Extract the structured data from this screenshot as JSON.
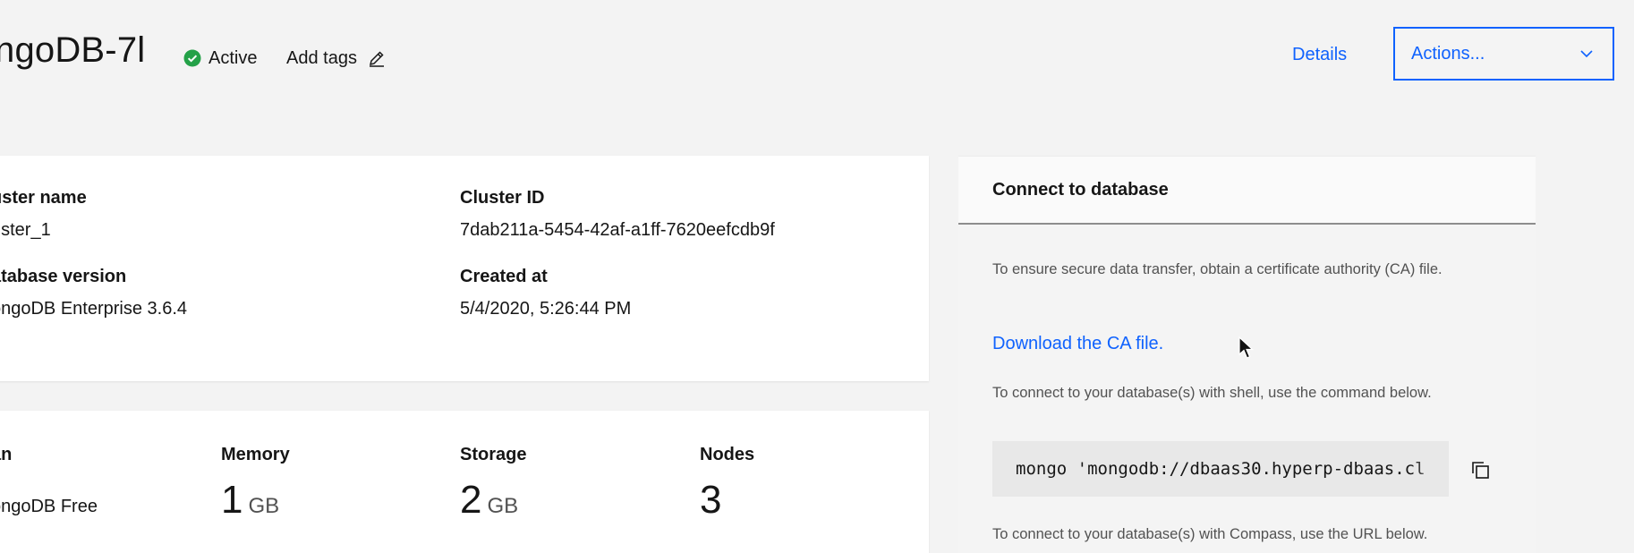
{
  "header": {
    "title": "ngoDB-7l",
    "status": "Active",
    "status_color": "#24a148",
    "add_tags_label": "Add tags",
    "details_label": "Details",
    "actions_label": "Actions..."
  },
  "overview": {
    "cluster_name_label": "uster name",
    "cluster_name_value": "uster_1",
    "cluster_id_label": "Cluster ID",
    "cluster_id_value": "7dab211a-5454-42af-a1ff-7620eefcdb9f",
    "db_version_label": "atabase version",
    "db_version_value": "ongoDB Enterprise 3.6.4",
    "created_at_label": "Created at",
    "created_at_value": "5/4/2020, 5:26:44 PM"
  },
  "plan": {
    "plan_label": "an",
    "plan_value": "ongoDB Free",
    "memory_label": "Memory",
    "memory_value": "1",
    "memory_unit": "GB",
    "storage_label": "Storage",
    "storage_value": "2",
    "storage_unit": "GB",
    "nodes_label": "Nodes",
    "nodes_value": "3"
  },
  "connect": {
    "title": "Connect to database",
    "ca_text": "To ensure secure data transfer, obtain a certificate authority (CA) file.",
    "ca_link": "Download the CA file.",
    "shell_text": "To connect to your database(s) with shell, use the command below.",
    "shell_command": "mongo 'mongodb://dbaas30.hyperp-dbaas.cl",
    "compass_text": "To connect to your database(s) with Compass, use the URL below."
  },
  "colors": {
    "accent": "#0f62fe",
    "background": "#f3f3f3"
  },
  "icons": {
    "status": "check-circle-icon",
    "edit": "pencil-icon",
    "actions": "chevron-down-icon",
    "copy": "copy-icon",
    "cursor": "mouse-pointer-icon"
  }
}
